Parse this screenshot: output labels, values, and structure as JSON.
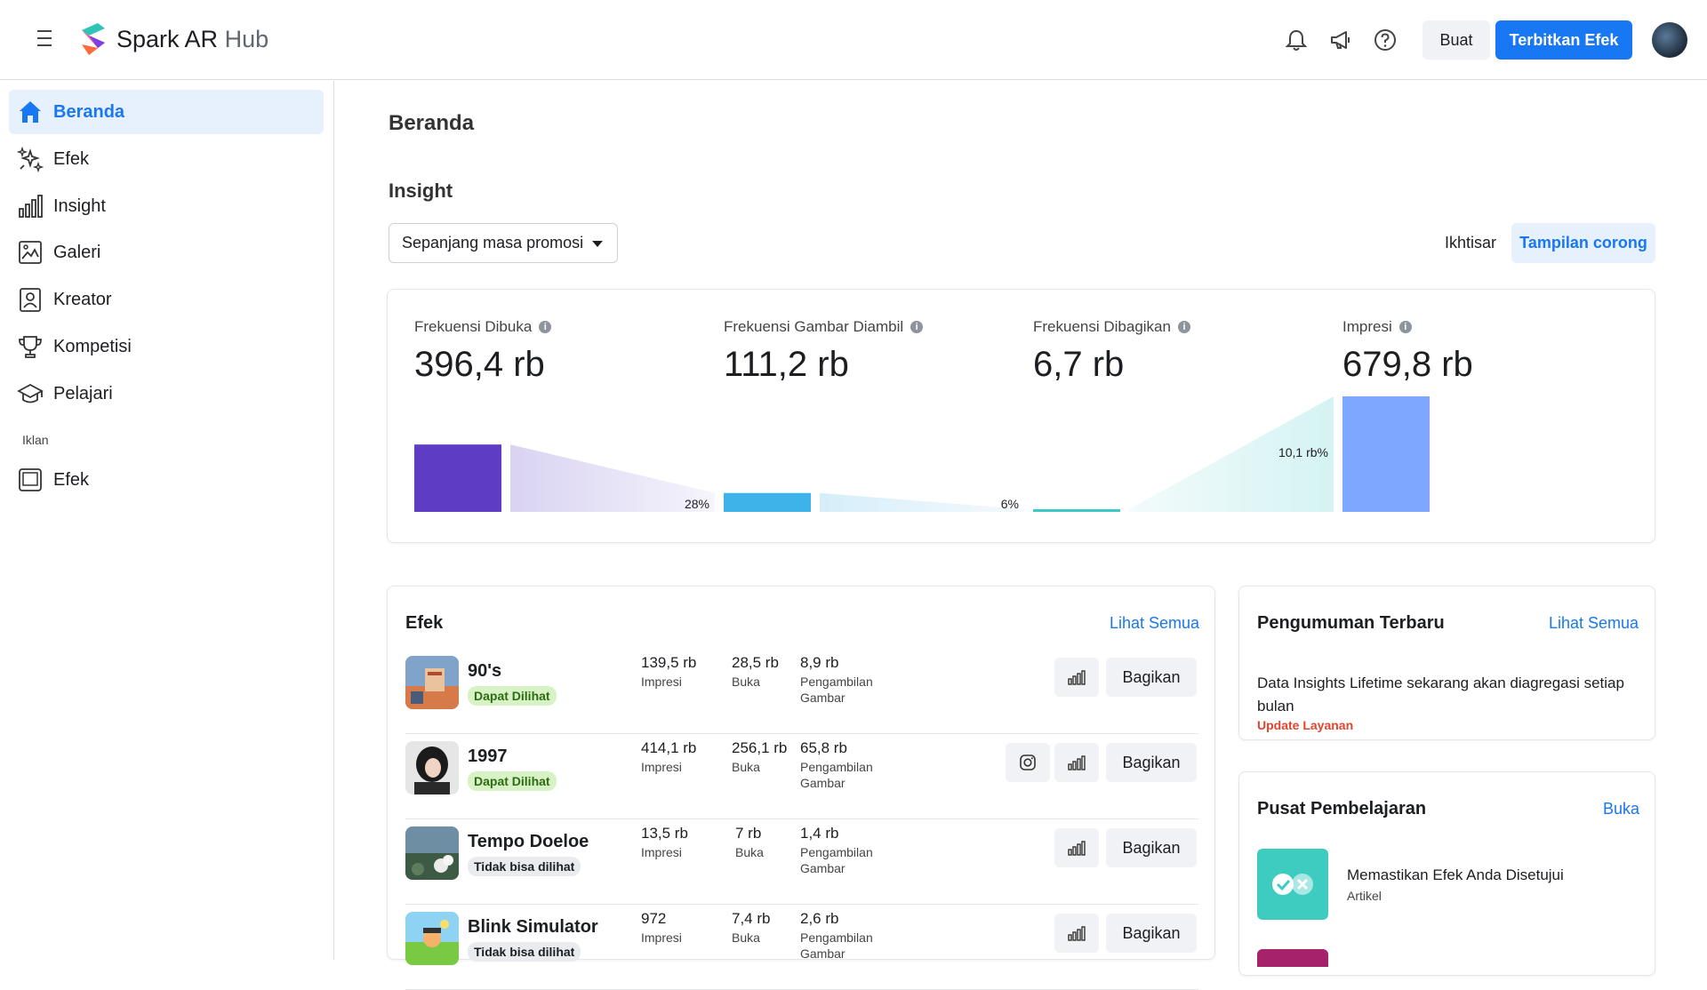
{
  "header": {
    "brand_main": "Spark AR",
    "brand_sub": "Hub",
    "icons": [
      "bell-icon",
      "megaphone-icon",
      "help-icon"
    ],
    "create_label": "Buat",
    "publish_label": "Terbitkan Efek",
    "accent": "#1877f2"
  },
  "sidebar": {
    "items": [
      {
        "label": "Beranda",
        "icon": "home-icon",
        "active": true
      },
      {
        "label": "Efek",
        "icon": "sparkles-icon"
      },
      {
        "label": "Insight",
        "icon": "bar-chart-icon"
      },
      {
        "label": "Galeri",
        "icon": "gallery-icon"
      },
      {
        "label": "Kreator",
        "icon": "creator-icon"
      },
      {
        "label": "Kompetisi",
        "icon": "trophy-icon"
      },
      {
        "label": "Pelajari",
        "icon": "graduation-cap-icon"
      }
    ],
    "section_label": "Iklan",
    "ads_items": [
      {
        "label": "Efek",
        "icon": "ad-frame-icon"
      }
    ]
  },
  "main": {
    "page_title": "Beranda",
    "insight_title": "Insight",
    "period_select": "Sepanjang masa promosi",
    "view_overview": "Ikhtisar",
    "view_funnel": "Tampilan corong"
  },
  "funnel": {
    "metrics": [
      {
        "label": "Frekuensi Dibuka",
        "value": "396,4 rb",
        "color": "#5e3cc4"
      },
      {
        "label": "Frekuensi Gambar Diambil",
        "value": "111,2 rb",
        "color": "#3db3ea"
      },
      {
        "label": "Frekuensi Dibagikan",
        "value": "6,7 rb",
        "color": "#3cc9c9"
      },
      {
        "label": "Impresi",
        "value": "679,8 rb",
        "color": "#7ea8ff"
      }
    ],
    "conversions": [
      "28%",
      "6%",
      "10,1 rb%"
    ]
  },
  "chart_data": {
    "type": "bar",
    "categories": [
      "Frekuensi Dibuka",
      "Frekuensi Gambar Diambil",
      "Frekuensi Dibagikan",
      "Impresi"
    ],
    "values": [
      396.4,
      111.2,
      6.7,
      679.8
    ],
    "value_unit": "rb",
    "annotations": [
      "28%",
      "6%",
      "10,1 rb%"
    ]
  },
  "effects": {
    "title": "Efek",
    "see_all": "Lihat Semua",
    "share_label": "Bagikan",
    "rows": [
      {
        "name": "90's",
        "status": "Dapat Dilihat",
        "visible": true,
        "impressions": "139,5 rb",
        "opens": "28,5 rb",
        "captures": "8,9 rb",
        "instagram": false
      },
      {
        "name": "1997",
        "status": "Dapat Dilihat",
        "visible": true,
        "impressions": "414,1 rb",
        "opens": "256,1 rb",
        "captures": "65,8 rb",
        "instagram": true
      },
      {
        "name": "Tempo Doeloe",
        "status": "Tidak bisa dilihat",
        "visible": false,
        "impressions": "13,5 rb",
        "opens": "7 rb",
        "captures": "1,4 rb",
        "instagram": false
      },
      {
        "name": "Blink Simulator",
        "status": "Tidak bisa dilihat",
        "visible": false,
        "impressions": "972",
        "opens": "7,4 rb",
        "captures": "2,6 rb",
        "instagram": false
      }
    ],
    "labels": {
      "impressions": "Impresi",
      "opens": "Buka",
      "captures": "Pengambilan Gambar"
    }
  },
  "announcements": {
    "title": "Pengumuman Terbaru",
    "see_all": "Lihat Semua",
    "text": "Data Insights Lifetime sekarang akan diagregasi setiap bulan",
    "tag": "Update Layanan"
  },
  "learning": {
    "title": "Pusat Pembelajaran",
    "open": "Buka",
    "item_title": "Memastikan Efek Anda Disetujui",
    "item_type": "Artikel"
  }
}
